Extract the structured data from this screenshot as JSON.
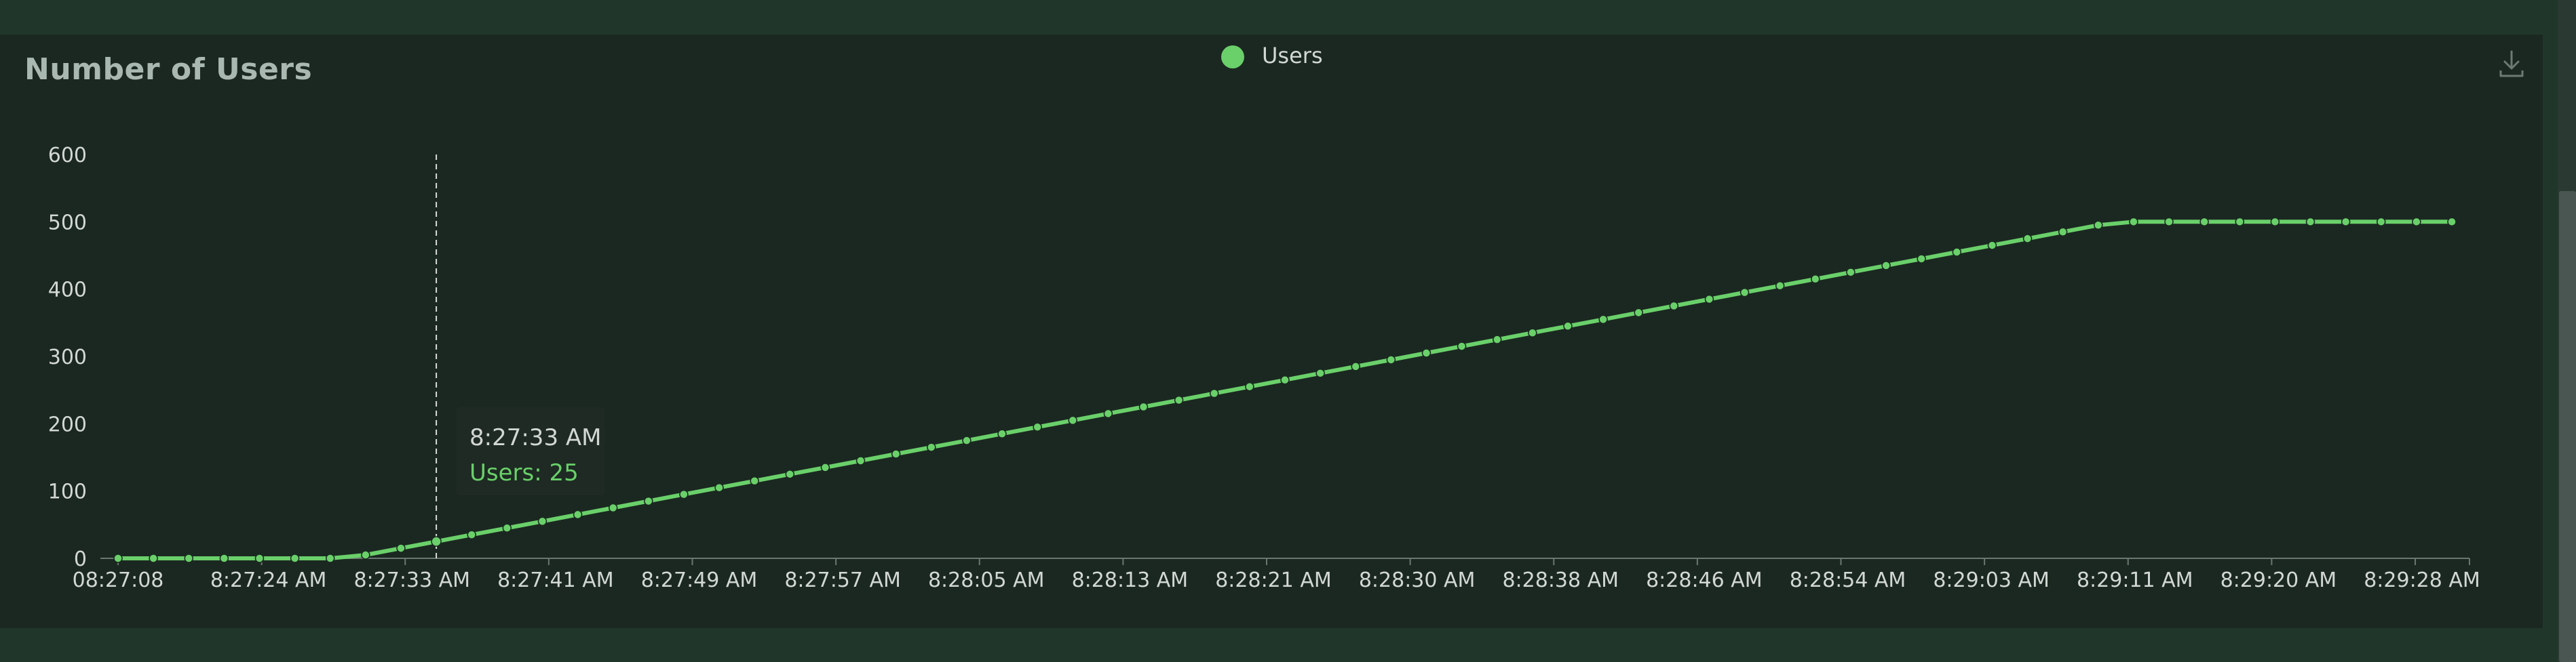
{
  "panel": {
    "title": "Number of Users",
    "download_icon": "download-icon"
  },
  "colors": {
    "series": "#6ad06a",
    "background": "#1b2821",
    "axis_text": "#d2d8d4"
  },
  "tooltip": {
    "time": "8:27:33 AM",
    "label": "Users: 25"
  },
  "chart_data": {
    "type": "line",
    "title": "Number of Users",
    "xlabel": "",
    "ylabel": "",
    "ylim": [
      0,
      600
    ],
    "yticks": [
      0,
      100,
      200,
      300,
      400,
      500,
      600
    ],
    "grid": false,
    "legend_position": "top-center",
    "x_tick_labels": [
      "08:27:08",
      "8:27:24 AM",
      "8:27:33 AM",
      "8:27:41 AM",
      "8:27:49 AM",
      "8:27:57 AM",
      "8:28:05 AM",
      "8:28:13 AM",
      "8:28:21 AM",
      "8:28:30 AM",
      "8:28:38 AM",
      "8:28:46 AM",
      "8:28:54 AM",
      "8:29:03 AM",
      "8:29:11 AM",
      "8:29:20 AM",
      "8:29:28 AM"
    ],
    "series": [
      {
        "name": "Users",
        "color": "#6ad06a",
        "values": [
          0,
          0,
          0,
          0,
          0,
          0,
          0,
          5,
          15,
          25,
          35,
          45,
          55,
          65,
          75,
          85,
          95,
          105,
          115,
          125,
          135,
          145,
          155,
          165,
          175,
          185,
          195,
          205,
          215,
          225,
          235,
          245,
          255,
          265,
          275,
          285,
          295,
          305,
          315,
          325,
          335,
          345,
          355,
          365,
          375,
          385,
          395,
          405,
          415,
          425,
          435,
          445,
          455,
          465,
          475,
          485,
          495,
          500,
          500,
          500,
          500,
          500,
          500,
          500,
          500,
          500,
          500
        ]
      }
    ],
    "highlight_index": 9
  }
}
